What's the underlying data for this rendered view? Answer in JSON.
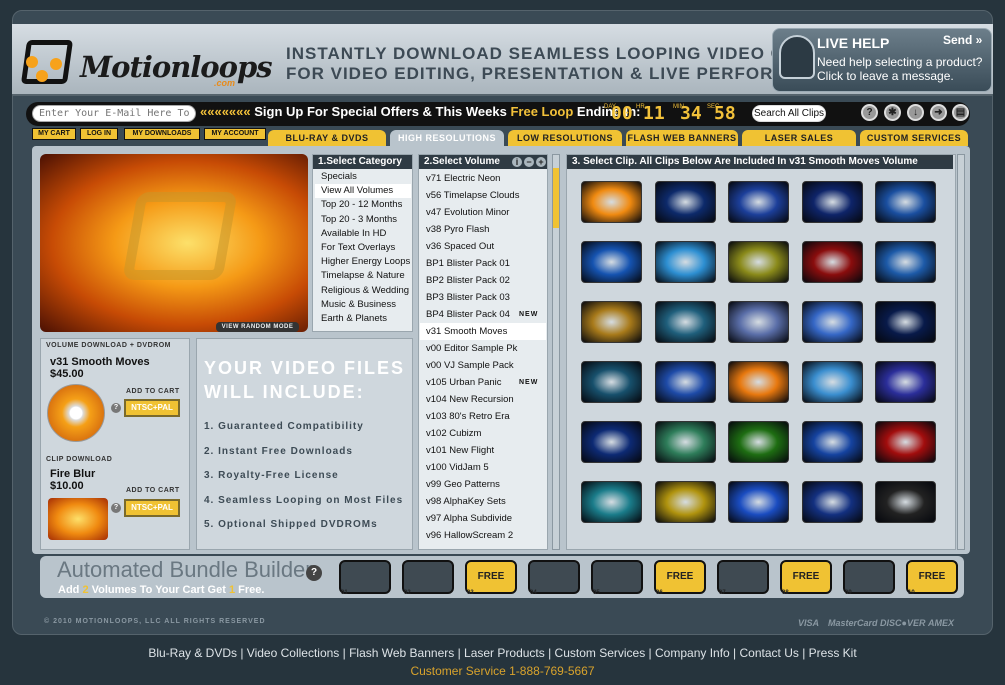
{
  "brand": {
    "name": "Motionloops",
    "domain": ".com"
  },
  "tagline": {
    "line1": "INSTANTLY DOWNLOAD SEAMLESS LOOPING VIDEO CLIPS",
    "line2": "FOR VIDEO EDITING, PRESENTATION & LIVE PERFORMANCE"
  },
  "live_help": {
    "title": "LIVE HELP",
    "send": "Send »",
    "text1": "Need help selecting a product?",
    "text2": "Click to leave a message."
  },
  "signup": {
    "placeholder": "Enter Your E-Mail Here To Sign Up",
    "arrows": "«««««««",
    "text": "Sign Up For Special Offers & This Weeks ",
    "free_loop": "Free Loop",
    "ending": " Ending In:",
    "days": "00",
    "hours": "11",
    "minutes": "34",
    "seconds": "58",
    "l_day": "DAY",
    "l_hr": "HR",
    "l_min": "MIN",
    "l_sec": "SEC"
  },
  "search_clips": "Search All Clips",
  "user_buttons": [
    "MY CART",
    "LOG IN",
    "MY DOWNLOADS",
    "MY ACCOUNT"
  ],
  "tabs": [
    "BLU-RAY & DVDS",
    "HIGH RESOLUTIONS",
    "LOW RESOLUTIONS",
    "FLASH WEB BANNERS",
    "LASER SALES",
    "CUSTOM SERVICES"
  ],
  "active_tab": "HIGH RESOLUTIONS",
  "preview": {
    "random_button": "VIEW RANDOM MODE"
  },
  "category": {
    "title": "1.Select Category",
    "items": [
      "Specials",
      "View All Volumes",
      "Top 20 - 12 Months",
      "Top 20 - 3 Months",
      "Available In HD",
      "For Text Overlays",
      "Higher Energy Loops",
      "Timelapse & Nature",
      "Religious & Wedding",
      "Music & Business",
      "Earth & Planets"
    ],
    "selected": "View All Volumes"
  },
  "volume": {
    "title": "2.Select Volume",
    "items": [
      "v71 Electric Neon",
      "v56 Timelapse Clouds",
      "v47 Evolution Minor",
      "v38 Pyro Flash",
      "v36 Spaced Out",
      "BP1 Blister Pack 01",
      "BP2 Blister Pack 02",
      "BP3 Blister Pack 03",
      "BP4 Blister Pack 04",
      "v31 Smooth Moves",
      "v00 Editor Sample Pk",
      "v00 VJ Sample Pack",
      "v105 Urban Panic",
      "v104 New Recursion",
      "v103 80's Retro Era",
      "v102 Cubizm",
      "v101 New Flight",
      "v100 VidJam 5",
      "v99 Geo Patterns",
      "v98 AlphaKey Sets",
      "v97 Alpha Subdivide",
      "v96 HallowScream 2"
    ],
    "selected": "v31 Smooth Moves",
    "new_label": "NEW"
  },
  "clips": {
    "title": "3. Select Clip. All Clips Below Are Included In v31 Smooth Moves Volume",
    "thumbs": [
      [
        "#f08a10",
        "#0d2a6b",
        "#1c3f9a",
        "#0e2469",
        "#1a4fa0"
      ],
      [
        "#1553b0",
        "#2d8fd2",
        "#8a8a1a",
        "#8a0d0d",
        "#1d5aa8"
      ],
      [
        "#a87a1a",
        "#1f5f7c",
        "#5a6ea8",
        "#3567c6",
        "#081a4a"
      ],
      [
        "#17506c",
        "#1e4ba8",
        "#e7780e",
        "#3a8ecf",
        "#2b2e9a"
      ],
      [
        "#0d2a74",
        "#2e7d5a",
        "#1e6d12",
        "#1543a0",
        "#a20d0d"
      ],
      [
        "#1a7c8a",
        "#b0930e",
        "#1a4cc0",
        "#133080",
        "#222222"
      ]
    ]
  },
  "product": {
    "vol_label": "VOLUME DOWNLOAD + DVDROM",
    "vol_name": "v31 Smooth Moves",
    "vol_price": "$45.00",
    "add_to_cart": "ADD TO CART",
    "format": "NTSC+PAL",
    "clip_label": "CLIP DOWNLOAD",
    "clip_name": "Fire Blur",
    "clip_price": "$10.00"
  },
  "video_files": {
    "title1": "YOUR VIDEO FILES",
    "title2": "WILL INCLUDE:",
    "items": [
      "1. Guaranteed Compatibility",
      "2. Instant Free Downloads",
      "3. Royalty-Free License",
      "4. Seamless Looping on Most Files",
      "5. Optional Shipped DVDROMs"
    ]
  },
  "bundle": {
    "title": "Automated Bundle Builder",
    "sub_add": "Add ",
    "sub_n": "2",
    "sub_mid": " Volumes To Your Cart Get ",
    "sub_free": "1",
    "sub_end": " Free.",
    "slots": [
      {
        "num": "01",
        "label": ""
      },
      {
        "num": "02",
        "label": ""
      },
      {
        "num": "03",
        "label": "FREE"
      },
      {
        "num": "04",
        "label": ""
      },
      {
        "num": "05",
        "label": ""
      },
      {
        "num": "06",
        "label": "FREE"
      },
      {
        "num": "07",
        "label": ""
      },
      {
        "num": "08",
        "label": "FREE"
      },
      {
        "num": "09",
        "label": ""
      },
      {
        "num": "10",
        "label": "FREE"
      }
    ]
  },
  "copyright": "© 2010 MOTIONLOOPS, LLC  ALL RIGHTS RESERVED",
  "cards": [
    "VISA",
    "MasterCard",
    "DISC●VER",
    "AMEX"
  ],
  "footer_links": "Blu-Ray & DVDs | Video Collections | Flash Web Banners | Laser Products | Custom Services | Company Info | Contact Us | Press Kit",
  "customer_service": "Customer Service 1-888-769-5667"
}
